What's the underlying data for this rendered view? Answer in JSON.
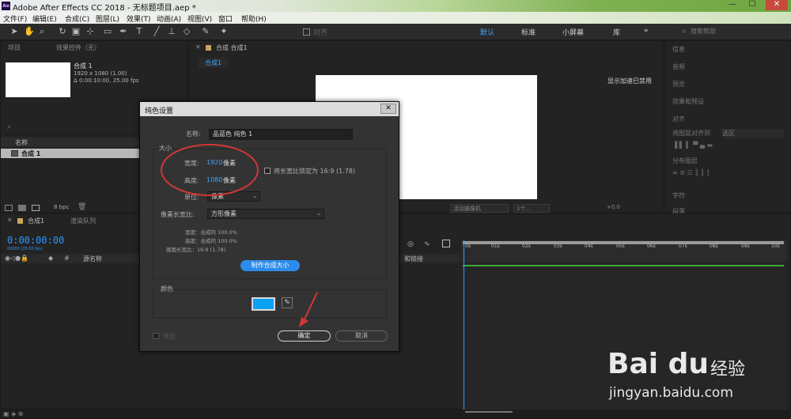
{
  "window": {
    "logo_text": "Ae",
    "title": "Adobe After Effects CC 2018 - 无标题项目.aep *",
    "minimize": "—",
    "maximize": "☐",
    "close": "✕"
  },
  "menu": [
    "文件(F)",
    "编辑(E)",
    "合成(C)",
    "图层(L)",
    "效果(T)",
    "动画(A)",
    "视图(V)",
    "窗口",
    "帮助(H)"
  ],
  "toolbar": {
    "snap_label": "对齐",
    "workspaces": [
      "默认",
      "标准",
      "小屏幕",
      "库"
    ],
    "overflow": "»",
    "search_placeholder": "搜索帮助"
  },
  "project_panel": {
    "tab_project": "项目",
    "tab_effects": "效果控件（无）",
    "comp_name": "合成 1",
    "comp_res": "1920 x 1080 (1.00)",
    "comp_dur": "Δ 0:00:10:00, 25.00 fps",
    "column_name": "名称",
    "row_item": "合成 1",
    "bpc": "8 bpc"
  },
  "viewer": {
    "tab_label": "合成 合成1",
    "sub_tab": "合成1",
    "gpu_note": "显示加速已禁用",
    "camera": "活动摄像机",
    "views": "1个...",
    "exposure": "+0.0"
  },
  "right_panel": {
    "items": [
      "信息",
      "音频",
      "预览",
      "效果和预设",
      "对齐",
      "将图层对齐到",
      "选区",
      "分布图层",
      "字符",
      "段落"
    ]
  },
  "timeline": {
    "tab_comp": "合成1",
    "tab_render": "渲染队列",
    "timecode": "0:00:00:00",
    "fps_note": "00000 (25.00 fps)",
    "col_source": "源名称",
    "col_parent": "和链接",
    "ticks": [
      "0s",
      "01s",
      "02s",
      "03s",
      "04s",
      "05s",
      "06s",
      "07s",
      "08s",
      "09s",
      "10s"
    ]
  },
  "dialog": {
    "title": "纯色设置",
    "close": "✕",
    "name_label": "名称:",
    "name_value": "品蓝色 纯色 1",
    "size_group": "大小",
    "width_label": "宽度:",
    "width_value": "1920",
    "width_unit": "像素",
    "height_label": "高度:",
    "height_value": "1080",
    "height_unit": "像素",
    "lock_label": "将长宽比锁定为 16:9 (1.78)",
    "unit_label": "单位:",
    "unit_value": "像素",
    "par_label": "像素长宽比:",
    "par_value": "方形像素",
    "info_width": "宽度：合成的 100.0%",
    "info_height": "高度：合成的 100.0%",
    "info_frame": "画面长宽比：16:9 (1.78)",
    "make_comp_size": "制作合成大小",
    "color_group": "颜色",
    "swatch_color": "#0aa2f5",
    "eyedropper": "eyedropper-icon",
    "preview": "预览",
    "ok": "确定",
    "cancel": "取消"
  },
  "watermark": {
    "logo": "Bai du",
    "cn": "经验",
    "url": "jingyan.baidu.com"
  }
}
